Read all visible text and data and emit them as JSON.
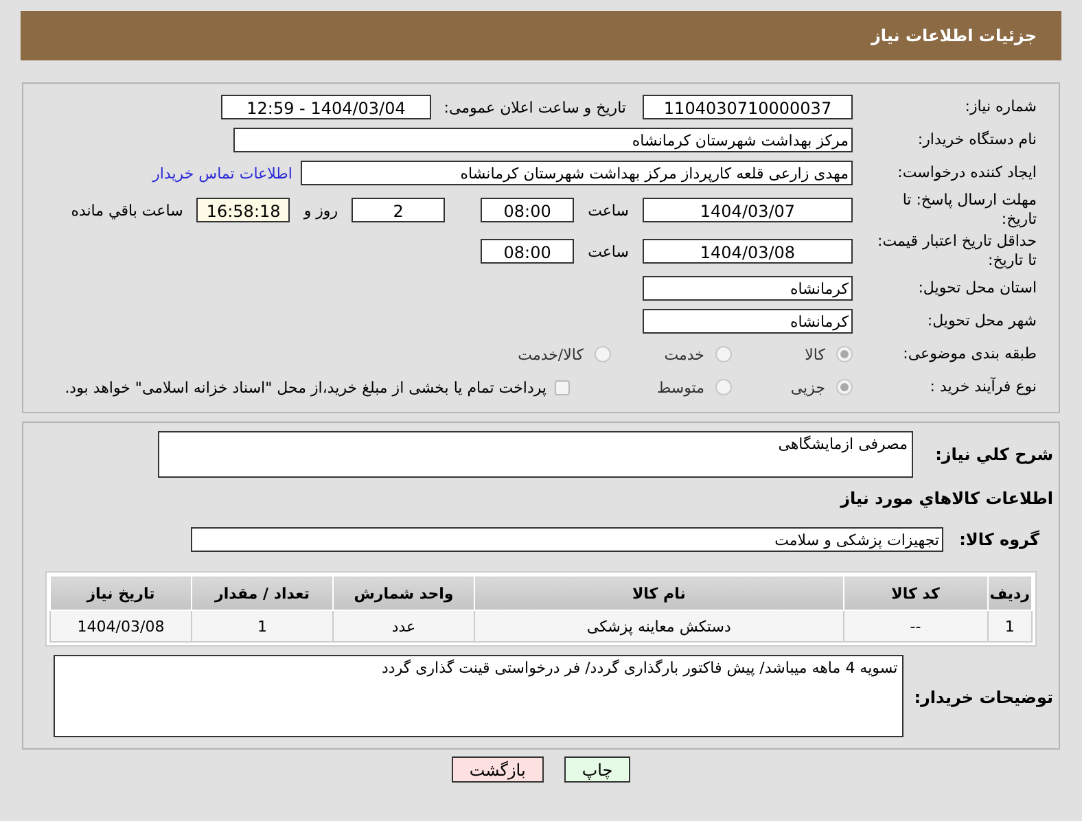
{
  "header": {
    "title": "جزئیات اطلاعات نیاز"
  },
  "need_number": {
    "label": "شماره نیاز:",
    "value": "1104030710000037"
  },
  "announce": {
    "label": "تاریخ و ساعت اعلان عمومی:",
    "value": "1404/03/04 - 12:59"
  },
  "buyer_org": {
    "label": "نام دستگاه خریدار:",
    "value": "مرکز بهداشت شهرستان کرمانشاه"
  },
  "creator": {
    "label": "ایجاد کننده درخواست:",
    "value": "مهدی  زارعی قلعه کارپرداز مرکز بهداشت شهرستان کرمانشاه",
    "link": "اطلاعات تماس خریدار"
  },
  "deadline": {
    "label": "مهلت ارسال پاسخ: تا تاریخ:",
    "date": "1404/03/07",
    "time_label": "ساعت",
    "time": "08:00",
    "days": "2",
    "days_label": "روز و",
    "remaining": "16:58:18",
    "remaining_label": "ساعت باقي مانده"
  },
  "validity": {
    "label": "حداقل تاریخ اعتبار قیمت: تا تاریخ:",
    "date": "1404/03/08",
    "time_label": "ساعت",
    "time": "08:00"
  },
  "province": {
    "label": "استان محل تحویل:",
    "value": "کرمانشاه"
  },
  "city": {
    "label": "شهر محل تحویل:",
    "value": "کرمانشاه"
  },
  "category": {
    "label": "طبقه بندی موضوعی:",
    "options": [
      {
        "label": "کالا",
        "selected": true
      },
      {
        "label": "خدمت",
        "selected": false
      },
      {
        "label": "کالا/خدمت",
        "selected": false
      }
    ]
  },
  "process": {
    "label": "نوع فرآیند خرید :",
    "options": [
      {
        "label": "جزیی",
        "selected": true
      },
      {
        "label": "متوسط",
        "selected": false
      }
    ],
    "treasury": {
      "label": "پرداخت تمام یا بخشی از مبلغ خرید،از محل \"اسناد خزانه اسلامی\" خواهد بود.",
      "checked": false
    }
  },
  "description": {
    "label": "شرح کلي نياز:",
    "value": "مصرفی ازمایشگاهی"
  },
  "items_heading": "اطلاعات کالاهاي مورد نياز",
  "goods_group": {
    "label": "گروه کالا:",
    "value": "تجهیزات پزشکی و سلامت"
  },
  "table": {
    "columns": [
      "رديف",
      "کد کالا",
      "نام کالا",
      "واحد شمارش",
      "تعداد / مقدار",
      "تاريخ نياز"
    ],
    "rows": [
      [
        "1",
        "--",
        "دستکش معاینه پزشکی",
        "عدد",
        "1",
        "1404/03/08"
      ]
    ]
  },
  "buyer_notes": {
    "label": "توضیحات خریدار:",
    "value": "تسویه 4 ماهه میباشد/ پیش فاکتور بارگذاری گردد/ فر درخواستی قینت گذاری گردد"
  },
  "buttons": [
    {
      "label": "چاپ",
      "kind": "print"
    },
    {
      "label": "بازگشت",
      "kind": "back"
    }
  ]
}
